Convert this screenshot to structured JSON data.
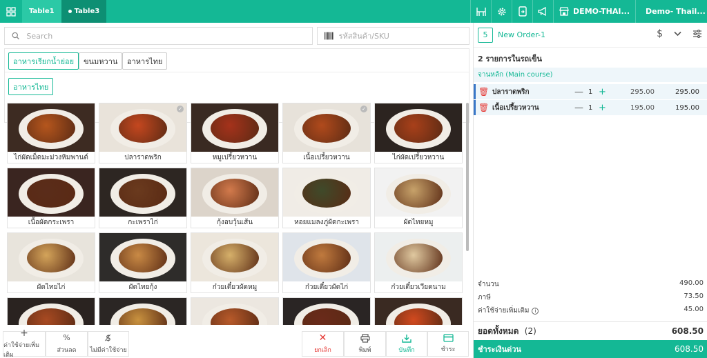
{
  "topbar": {
    "tabs": [
      {
        "label": "Table1",
        "active": true
      },
      {
        "label": "Table3",
        "has_dot": true
      }
    ],
    "store_name": "DEMO-THAI...",
    "user_name": "Demo- Thail...",
    "icons": [
      "grid-icon",
      "table-icon",
      "gear-icon",
      "phone-transfer-icon",
      "megaphone-icon",
      "store-icon",
      "user-icon"
    ],
    "accent_color": "#14b895"
  },
  "search": {
    "placeholder": "Search",
    "sku_placeholder": "รหัสสินค้า/SKU"
  },
  "categories": {
    "row1": [
      "อาหารเรียกน้ำย่อย",
      "ขนมหวาน",
      "อาหารไทย"
    ],
    "row2": [
      "อาหารไทย"
    ]
  },
  "products": [
    {
      "name": "ไก่ผัดเม็ดมะม่วงหิมพานต์",
      "checked": false
    },
    {
      "name": "ปลาราดพริก",
      "checked": true
    },
    {
      "name": "หมูเปรี้ยวหวาน",
      "checked": false
    },
    {
      "name": "เนื้อเปรี้ยวหวาน",
      "checked": true
    },
    {
      "name": "ไก่ผัดเปรี้ยวหวาน",
      "checked": false
    },
    {
      "name": "เนื้อผัดกระเพรา",
      "checked": false
    },
    {
      "name": "กะเพราไก่",
      "checked": false
    },
    {
      "name": "กุ้งอบวุ้นเส้น",
      "checked": false
    },
    {
      "name": "หอยแมลงภู่ผัดกะเพรา",
      "checked": false
    },
    {
      "name": "ผัดไทยหมู",
      "checked": false
    },
    {
      "name": "ผัดไทยไก่",
      "checked": false
    },
    {
      "name": "ผัดไทยกุ้ง",
      "checked": false
    },
    {
      "name": "ก๋วยเตี๋ยวผัดหมู",
      "checked": false
    },
    {
      "name": "ก๋วยเตี๋ยวผัดไก่",
      "checked": false
    },
    {
      "name": "ก๋วยเตี๋ยวเวียดนาม",
      "checked": false
    },
    {
      "name": "",
      "checked": false
    },
    {
      "name": "",
      "checked": false
    },
    {
      "name": "",
      "checked": false
    },
    {
      "name": "",
      "checked": false
    },
    {
      "name": "",
      "checked": false
    }
  ],
  "actions": {
    "extra_charge": "ค่าใช้จ่ายเพิ่มเติม",
    "discount": "ส่วนลด",
    "no_charge": "ไม่มีค่าใช้จ่าย",
    "cancel": "ยกเลิก",
    "print": "พิมพ์",
    "save": "บันทึก",
    "pay": "ชำระ",
    "cancel_color": "#e53935",
    "save_color": "#14b895"
  },
  "order": {
    "number": "5",
    "name": "New Order-1",
    "cart_count": "2 รายการในรถเข็น",
    "group": "จานหลัก (Main course)",
    "items": [
      {
        "name": "ปลาราดพริก",
        "qty": "1",
        "price": "295.00",
        "total": "295.00"
      },
      {
        "name": "เนื้อเปรี้ยวหวาน",
        "qty": "1",
        "price": "195.00",
        "total": "195.00"
      }
    ],
    "summary": {
      "amount_label": "จำนวน",
      "amount": "490.00",
      "tax_label": "ภาษี",
      "tax": "73.50",
      "extra_label": "ค่าใช้จ่ายเพิ่มเติม",
      "extra": "45.00"
    },
    "grand_total_label": "ยอดทั้งหมด",
    "grand_total_count": "(2)",
    "grand_total": "608.50",
    "quick_pay_label": "ชำระเงินด่วน",
    "quick_pay_amount": "608.50"
  }
}
